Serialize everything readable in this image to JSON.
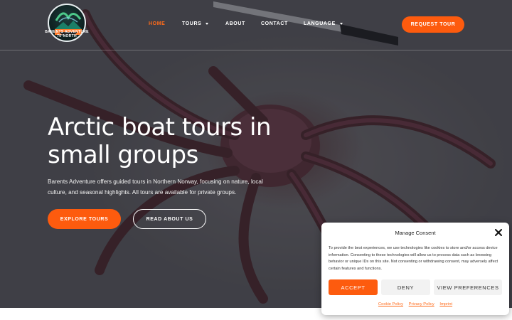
{
  "brand": {
    "logo_text_line1": "BARENTS ADVENTURE",
    "logo_text_line2": "70°NORTH"
  },
  "nav": {
    "items": [
      {
        "label": "HOME",
        "active": true
      },
      {
        "label": "TOURS",
        "dropdown": true
      },
      {
        "label": "ABOUT"
      },
      {
        "label": "CONTACT"
      },
      {
        "label": "LANGUAGE",
        "dropdown": true
      }
    ],
    "cta_label": "REQUEST TOUR"
  },
  "hero": {
    "headline": "Arctic boat tours in small groups",
    "intro": "Barents Adventure offers guided tours in Northern Norway, focusing on nature, local culture, and seasonal highlights. All tours are available for private groups.",
    "primary_button": "EXPLORE TOURS",
    "secondary_button": "READ ABOUT US"
  },
  "consent": {
    "title": "Manage Consent",
    "body": "To provide the best experiences, we use technologies like cookies to store and/or access device information. Consenting to these technologies will allow us to process data such as browsing behavior or unique IDs on this site. Not consenting or withdrawing consent, may adversely affect certain features and functions.",
    "accept_label": "ACCEPT",
    "deny_label": "DENY",
    "preferences_label": "VIEW PREFERENCES",
    "links": [
      "Cookie Policy",
      "Privacy Policy",
      "Imprint"
    ]
  },
  "colors": {
    "accent": "#fd5b0e",
    "active_nav": "#ff6b1a",
    "text_light": "#ffffff"
  },
  "icons": [
    "close-icon",
    "chevron-down-icon",
    "logo-icon"
  ]
}
